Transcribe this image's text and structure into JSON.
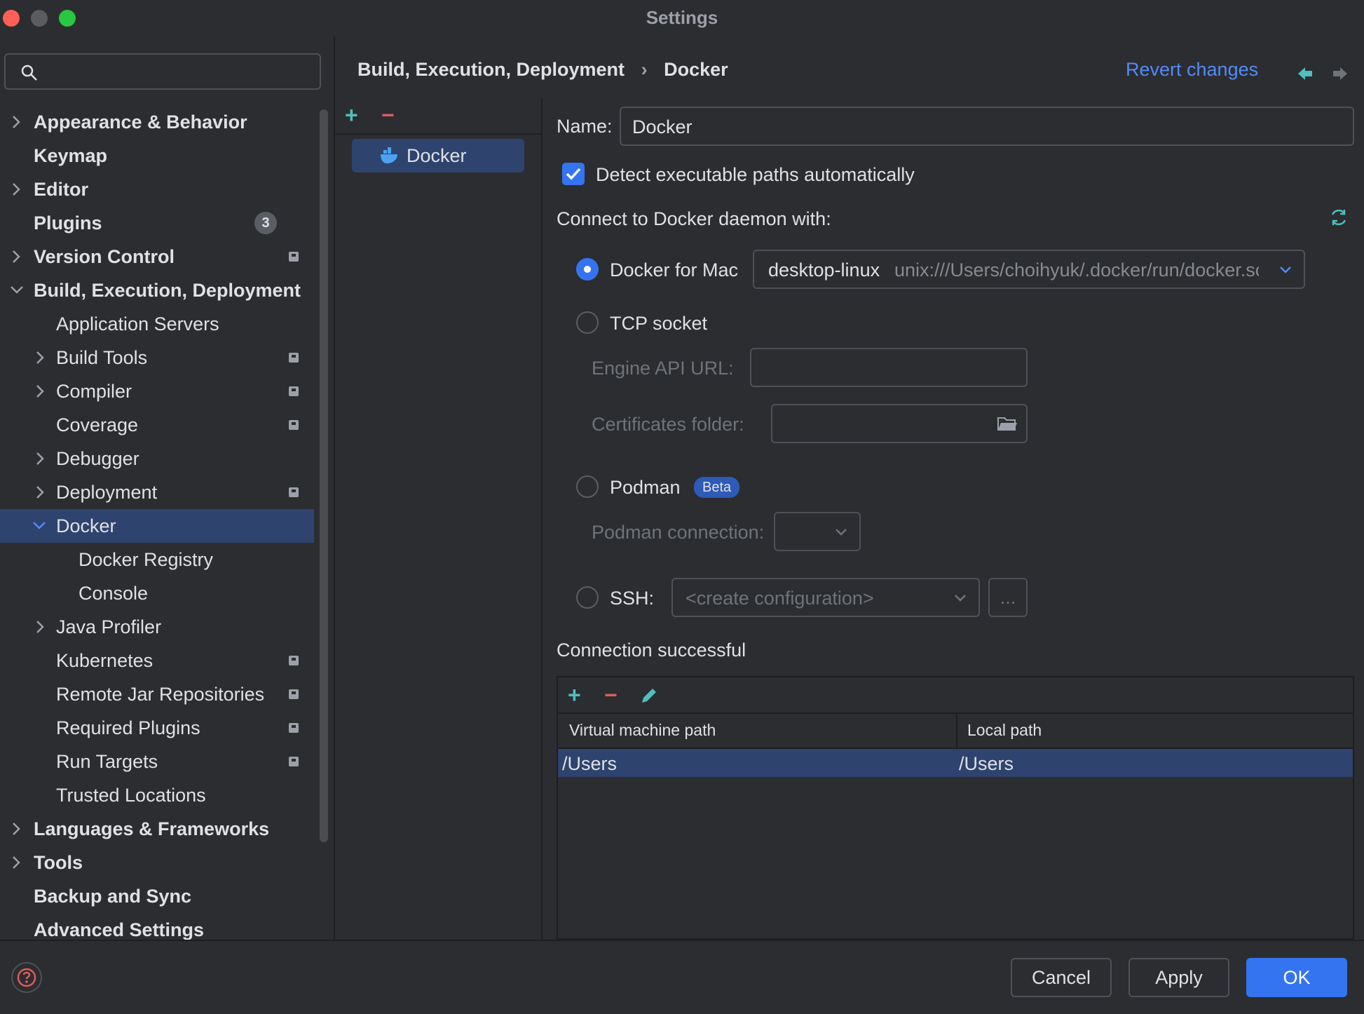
{
  "window": {
    "title": "Settings"
  },
  "search": {
    "placeholder": ""
  },
  "sidebar": {
    "items": [
      {
        "label": "Appearance & Behavior"
      },
      {
        "label": "Keymap"
      },
      {
        "label": "Editor"
      },
      {
        "label": "Plugins",
        "badge": "3"
      },
      {
        "label": "Version Control"
      },
      {
        "label": "Build, Execution, Deployment"
      },
      {
        "label": "Application Servers"
      },
      {
        "label": "Build Tools"
      },
      {
        "label": "Compiler"
      },
      {
        "label": "Coverage"
      },
      {
        "label": "Debugger"
      },
      {
        "label": "Deployment"
      },
      {
        "label": "Docker"
      },
      {
        "label": "Docker Registry"
      },
      {
        "label": "Console"
      },
      {
        "label": "Java Profiler"
      },
      {
        "label": "Kubernetes"
      },
      {
        "label": "Remote Jar Repositories"
      },
      {
        "label": "Required Plugins"
      },
      {
        "label": "Run Targets"
      },
      {
        "label": "Trusted Locations"
      },
      {
        "label": "Languages & Frameworks"
      },
      {
        "label": "Tools"
      },
      {
        "label": "Backup and Sync"
      },
      {
        "label": "Advanced Settings"
      }
    ]
  },
  "header": {
    "breadcrumb_parent": "Build, Execution, Deployment",
    "breadcrumb_separator": "›",
    "breadcrumb_current": "Docker",
    "revert_label": "Revert changes"
  },
  "middle": {
    "add_icon": "+",
    "remove_icon": "−",
    "list": [
      {
        "label": "Docker"
      }
    ]
  },
  "form": {
    "name_label": "Name:",
    "name_value": "Docker",
    "detect_label": "Detect executable paths automatically",
    "detect_checked": true,
    "connect_label": "Connect to Docker daemon with:",
    "docker_for_mac_label": "Docker for Mac",
    "context_name": "desktop-linux",
    "context_path": "unix:///Users/choihyuk/.docker/run/docker.sc",
    "tcp_label": "TCP socket",
    "engine_api_label": "Engine API URL:",
    "engine_api_value": "",
    "certs_label": "Certificates folder:",
    "certs_value": "",
    "podman_label": "Podman",
    "podman_badge": "Beta",
    "podman_conn_label": "Podman connection:",
    "ssh_label": "SSH:",
    "ssh_placeholder": "<create configuration>",
    "ssh_more": "...",
    "status": "Connection successful"
  },
  "mappings": {
    "columns": [
      "Virtual machine path",
      "Local path"
    ],
    "rows": [
      [
        "/Users",
        "/Users"
      ]
    ]
  },
  "buttons": {
    "cancel": "Cancel",
    "apply": "Apply",
    "ok": "OK"
  },
  "colors": {
    "accent": "#3574f0",
    "selection": "#2e436e",
    "add": "#4fbfbf",
    "remove": "#db5c5c",
    "link": "#548af7"
  }
}
